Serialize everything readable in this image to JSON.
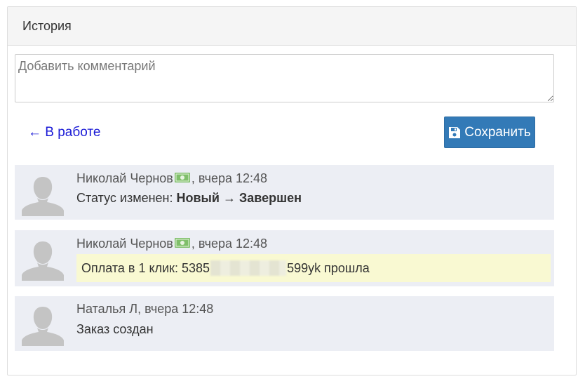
{
  "panel": {
    "title": "История"
  },
  "comment": {
    "placeholder": "Добавить комментарий",
    "value": ""
  },
  "actions": {
    "back_label": "← В работе",
    "save_label": "Сохранить",
    "save_icon": "floppy-disk-icon"
  },
  "history": [
    {
      "author": "Николай Чернов",
      "author_icon": "money-icon",
      "time": ", вчера 12:48",
      "status_prefix": "Статус изменен: ",
      "status_from": "Новый",
      "arrow": " → ",
      "status_to": "Завершен"
    },
    {
      "author": "Николай Чернов",
      "author_icon": "money-icon",
      "time": ", вчера 12:48",
      "payment_prefix": "Оплата в 1 клик: 5385",
      "payment_suffix": "599yk прошла"
    },
    {
      "author": "Наталья Л",
      "time": ", вчера 12:48",
      "text": "Заказ создан"
    }
  ],
  "colors": {
    "entry_bg": "#eceef4",
    "highlight_bg": "#f9f9d2",
    "primary": "#337ab7",
    "link": "#1a1ad6",
    "money_icon": "#7fbf6a"
  }
}
